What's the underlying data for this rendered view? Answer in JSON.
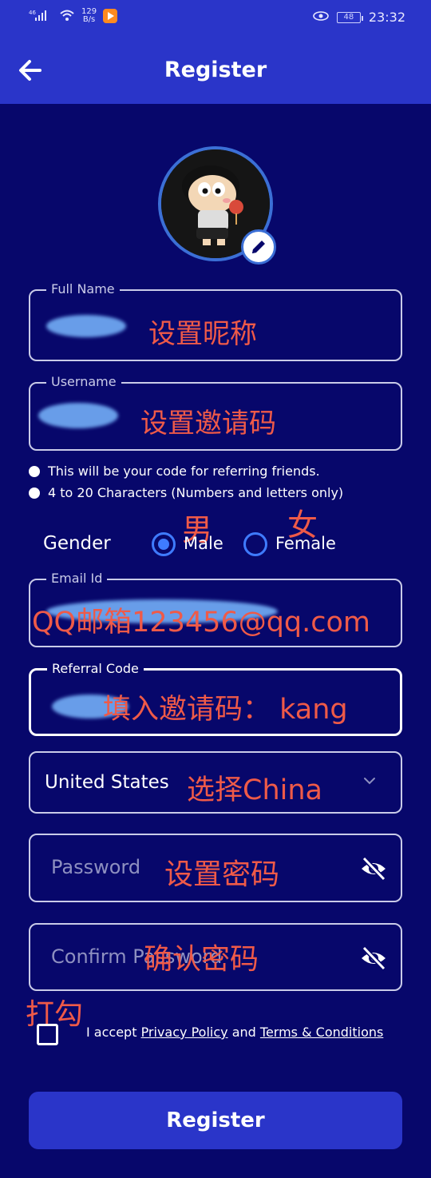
{
  "status_bar": {
    "signal": "46",
    "net_speed_value": "129",
    "net_speed_unit": "B/s",
    "battery": "48",
    "time": "23:32"
  },
  "header": {
    "title": "Register",
    "back_icon": "arrow-left-icon"
  },
  "avatar": {
    "edit_icon": "pencil-icon"
  },
  "full_name": {
    "label": "Full Name",
    "annotation": "设置昵称"
  },
  "username": {
    "label": "Username",
    "annotation": "设置邀请码",
    "hints": [
      "This will be your code for referring friends.",
      "4 to 20 Characters (Numbers and letters only)"
    ]
  },
  "gender": {
    "label": "Gender",
    "options": [
      {
        "label": "Male",
        "annotation": "男",
        "selected": true
      },
      {
        "label": "Female",
        "annotation": "女",
        "selected": false
      }
    ]
  },
  "email": {
    "label": "Email Id",
    "annotation": "QQ邮箱123456@qq.com"
  },
  "referral": {
    "label": "Referral Code",
    "annotation": "填入邀请码：  kang"
  },
  "country": {
    "value": "United States",
    "annotation": "选择China",
    "icon": "chevron-down-icon"
  },
  "password": {
    "placeholder": "Password",
    "annotation": "设置密码",
    "icon": "eye-off-icon"
  },
  "confirm_password": {
    "placeholder": "Confirm Password",
    "annotation": "确认密码",
    "icon": "eye-off-icon"
  },
  "terms": {
    "annotation": "打勾",
    "prefix": "I accept ",
    "privacy_link": "Privacy Policy",
    "middle": " and ",
    "terms_link": "Terms & Conditions"
  },
  "register_button": "Register",
  "colors": {
    "background": "#07076b",
    "header": "#2a35c9",
    "accent": "#3f7bff",
    "annotation": "#ef5a48",
    "redaction": "#6ea6f0"
  }
}
